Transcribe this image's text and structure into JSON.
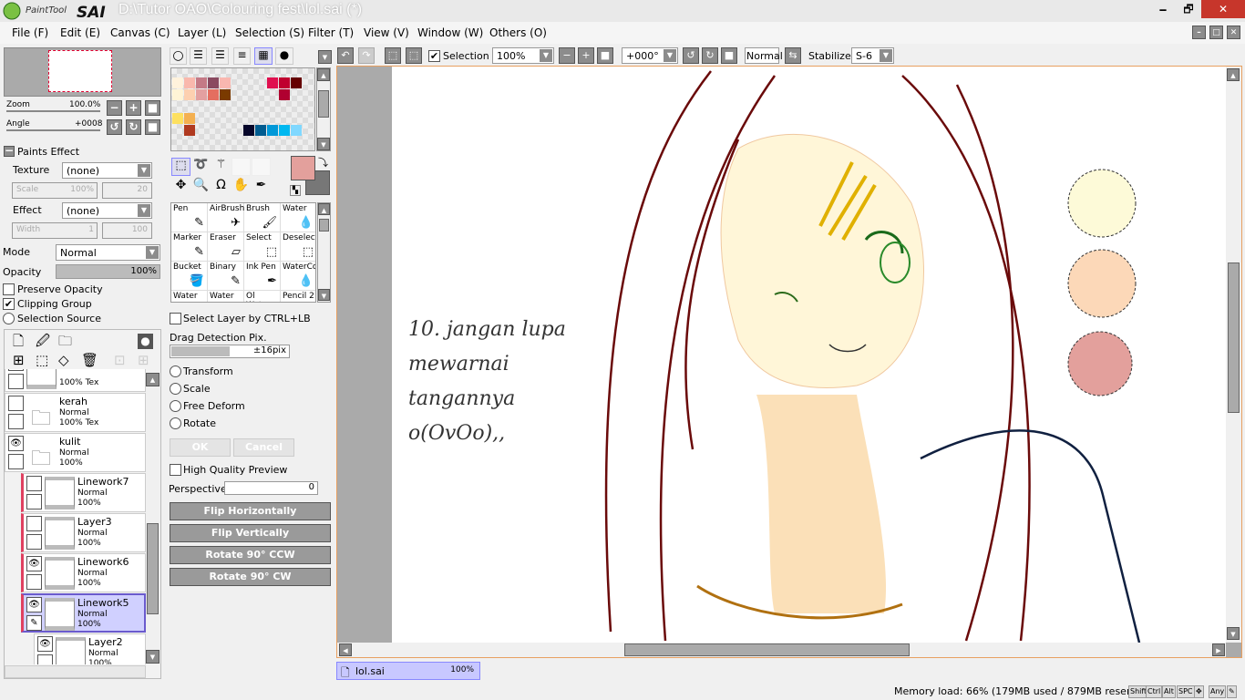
{
  "app": {
    "logo_text": "PaintTool SAI",
    "title": "D:\\Tutor OAO\\Colouring fest\\lol.sai (*)"
  },
  "window_controls": {
    "minimize": "🗕",
    "maximize": "🗗",
    "close": "✕"
  },
  "menu": [
    "File (F)",
    "Edit (E)",
    "Canvas (C)",
    "Layer (L)",
    "Selection (S)",
    "Filter (T)",
    "View (V)",
    "Window (W)",
    "Others (O)"
  ],
  "navigator": {
    "zoom_label": "Zoom",
    "zoom_value": "100.0%",
    "angle_label": "Angle",
    "angle_value": "+0008"
  },
  "paints_effect": {
    "header": "Paints Effect",
    "texture_label": "Texture",
    "texture_value": "(none)",
    "scale_label": "Scale",
    "scale_value": "100%",
    "scale_strength": "20",
    "effect_label": "Effect",
    "effect_value": "(none)",
    "width_label": "Width",
    "width_value": "1",
    "width_strength": "100"
  },
  "layer_props": {
    "mode_label": "Mode",
    "mode_value": "Normal",
    "opacity_label": "Opacity",
    "opacity_value": "100%",
    "opacity_fraction": 1.0,
    "preserve_opacity": "Preserve Opacity",
    "preserve_checked": false,
    "clipping_group": "Clipping Group",
    "clipping_checked": true,
    "selection_source": "Selection Source"
  },
  "layers": [
    {
      "name": "",
      "mode": "",
      "opacity": "100% Tex",
      "visible": false,
      "folder": false,
      "clipped": false,
      "selected": false,
      "partial": true
    },
    {
      "name": "kerah",
      "mode": "Normal",
      "opacity": "100% Tex",
      "visible": false,
      "folder": true,
      "clipped": false,
      "selected": false
    },
    {
      "name": "kulit",
      "mode": "Normal",
      "opacity": "100%",
      "visible": true,
      "folder": true,
      "clipped": false,
      "selected": false
    },
    {
      "name": "Linework7",
      "mode": "Normal",
      "opacity": "100%",
      "visible": false,
      "folder": false,
      "clipped": true,
      "selected": false
    },
    {
      "name": "Layer3",
      "mode": "Normal",
      "opacity": "100%",
      "visible": false,
      "folder": false,
      "clipped": true,
      "selected": false
    },
    {
      "name": "Linework6",
      "mode": "Normal",
      "opacity": "100%",
      "visible": true,
      "folder": false,
      "clipped": true,
      "selected": false
    },
    {
      "name": "Linework5",
      "mode": "Normal",
      "opacity": "100%",
      "visible": true,
      "folder": false,
      "clipped": true,
      "selected": true
    },
    {
      "name": "Layer2",
      "mode": "Normal",
      "opacity": "100%",
      "visible": true,
      "folder": false,
      "clipped": false,
      "selected": false
    }
  ],
  "palette": {
    "colors": [
      "#fff2dc",
      "#f9b8ad",
      "#c47a86",
      "#8a4a60",
      "#f9b7b0",
      "",
      "",
      "",
      "#e0104f",
      "#c0002f",
      "#650000",
      "",
      "#fff4d6",
      "#fdd0b0",
      "#e3a0a0",
      "#e46e60",
      "#7a3a00",
      "",
      "",
      "",
      "",
      "#b00030",
      "",
      "",
      "",
      "",
      "",
      "",
      "",
      "",
      "",
      "",
      "",
      "",
      "",
      "",
      "#fde060",
      "#f4b050",
      "",
      "",
      "",
      "",
      "",
      "",
      "",
      "",
      "",
      "",
      "",
      "#b03a20",
      "",
      "",
      "",
      "",
      "#06062a",
      "#005c90",
      "#0098d8",
      "#00b8f0",
      "#80d8ff",
      ""
    ]
  },
  "colors": {
    "primary": "#e3a09c",
    "secondary": "#777777",
    "accent_orange": "#e8a060"
  },
  "tools": [
    {
      "label": "Pen",
      "icon": "✎"
    },
    {
      "label": "AirBrush",
      "icon": "✈"
    },
    {
      "label": "Brush",
      "icon": "🖌"
    },
    {
      "label": "Water",
      "icon": "💧"
    },
    {
      "label": "Marker",
      "icon": "✎"
    },
    {
      "label": "Eraser",
      "icon": "▱"
    },
    {
      "label": "Select",
      "icon": "⬚"
    },
    {
      "label": "Deselect",
      "icon": "⬚"
    },
    {
      "label": "Bucket",
      "icon": "🪣"
    },
    {
      "label": "Binary",
      "icon": "✎"
    },
    {
      "label": "Ink Pen",
      "icon": "✒"
    },
    {
      "label": "WaterCo",
      "icon": "💧"
    },
    {
      "label": "Water",
      "icon": ""
    },
    {
      "label": "Water",
      "icon": ""
    },
    {
      "label": "Ol Water",
      "icon": ""
    },
    {
      "label": "Pencil 2",
      "icon": ""
    }
  ],
  "tool_options": {
    "select_layer": "Select Layer by CTRL+LB",
    "drag_label": "Drag Detection Pix.",
    "drag_value": "±16pix",
    "transform": "Transform",
    "scale": "Scale",
    "free_deform": "Free Deform",
    "rotate": "Rotate",
    "ok": "OK",
    "cancel": "Cancel",
    "hq_preview": "High Quality Preview",
    "perspective_label": "Perspective",
    "perspective_value": "0",
    "flip_h": "Flip Horizontally",
    "flip_v": "Flip Vertically",
    "rot_ccw": "Rotate 90° CCW",
    "rot_cw": "Rotate 90° CW"
  },
  "canvas_toolbar": {
    "selection_label": "Selection",
    "selection_checked": true,
    "zoom": "100%",
    "angle": "+000°",
    "blend": "Normal",
    "stabilizer_label": "Stabilizer",
    "stabilizer_value": "S-6"
  },
  "canvas": {
    "annotation": [
      "10. jangan lupa",
      "mewarnai",
      "tangannya",
      "o(OvOo),,"
    ],
    "swatches": [
      "#fdfad8",
      "#fcd8b8",
      "#e3a09c"
    ]
  },
  "tab": {
    "name": "lol.sai",
    "zoom": "100%"
  },
  "status": {
    "memory": "Memory load: 66% (179MB used / 879MB reserved)",
    "keys": [
      "Shift",
      "Ctrl",
      "Alt",
      "SPC",
      "✥",
      "Any",
      "✎"
    ]
  }
}
